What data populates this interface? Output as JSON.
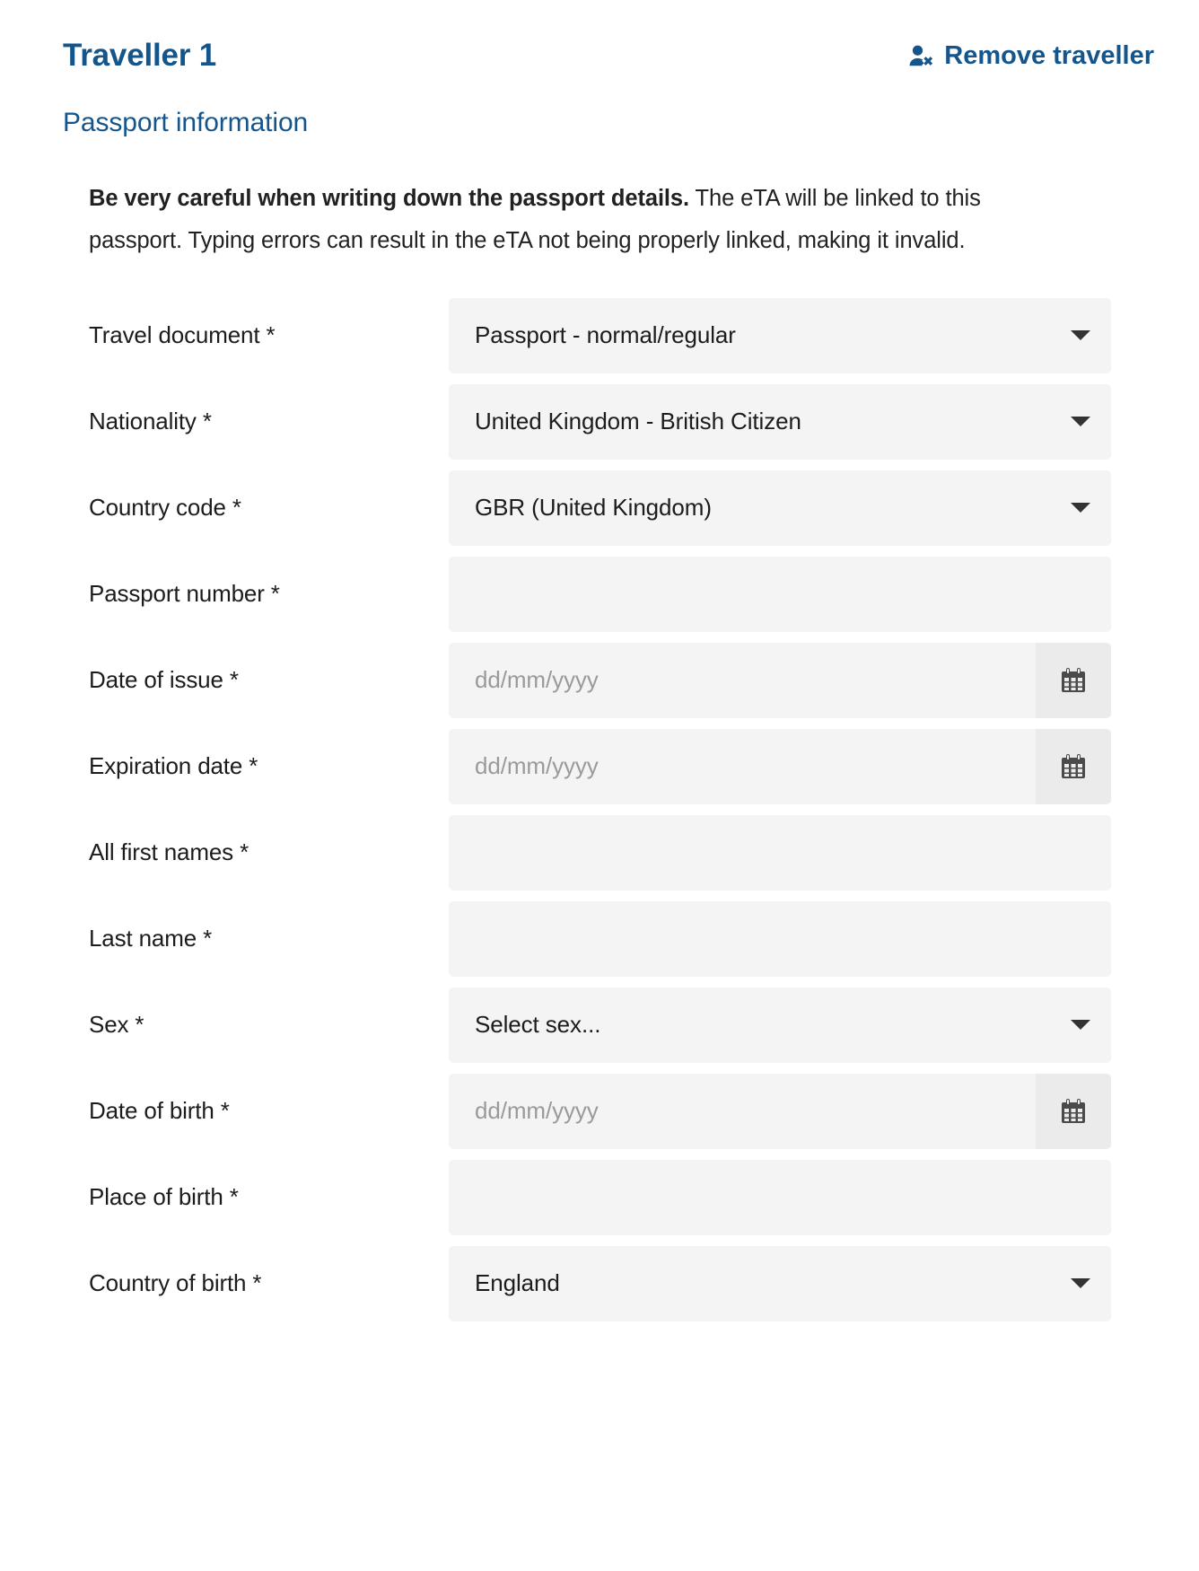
{
  "header": {
    "traveller_title": "Traveller 1",
    "remove_label": "Remove traveller",
    "remove_icon": "user-remove-icon",
    "section_subtitle": "Passport information"
  },
  "intro": {
    "bold": "Be very careful when writing down the passport details.",
    "rest": " The eTA will be linked to this passport. Typing errors can result in the eTA not being properly linked, making it invalid."
  },
  "colors": {
    "brand_blue": "#14558c",
    "field_bg": "#f4f4f4",
    "calendar_btn_bg": "#ebebeb",
    "placeholder": "#9a9a9a",
    "text": "#1c1c1c"
  },
  "form": {
    "fields": [
      {
        "label": "Travel document *",
        "type": "select",
        "value": "Passport - normal/regular",
        "placeholder": ""
      },
      {
        "label": "Nationality *",
        "type": "select",
        "value": "United Kingdom - British Citizen",
        "placeholder": ""
      },
      {
        "label": "Country code *",
        "type": "select",
        "value": "GBR (United Kingdom)",
        "placeholder": ""
      },
      {
        "label": "Passport number *",
        "type": "text",
        "value": "",
        "placeholder": ""
      },
      {
        "label": "Date of issue *",
        "type": "date",
        "value": "",
        "placeholder": "dd/mm/yyyy"
      },
      {
        "label": "Expiration date *",
        "type": "date",
        "value": "",
        "placeholder": "dd/mm/yyyy"
      },
      {
        "label": "All first names *",
        "type": "text",
        "value": "",
        "placeholder": ""
      },
      {
        "label": "Last name *",
        "type": "text",
        "value": "",
        "placeholder": ""
      },
      {
        "label": "Sex *",
        "type": "select",
        "value": "Select sex...",
        "placeholder": ""
      },
      {
        "label": "Date of birth *",
        "type": "date",
        "value": "",
        "placeholder": "dd/mm/yyyy"
      },
      {
        "label": "Place of birth *",
        "type": "text",
        "value": "",
        "placeholder": ""
      },
      {
        "label": "Country of birth *",
        "type": "select",
        "value": "England",
        "placeholder": ""
      }
    ]
  }
}
